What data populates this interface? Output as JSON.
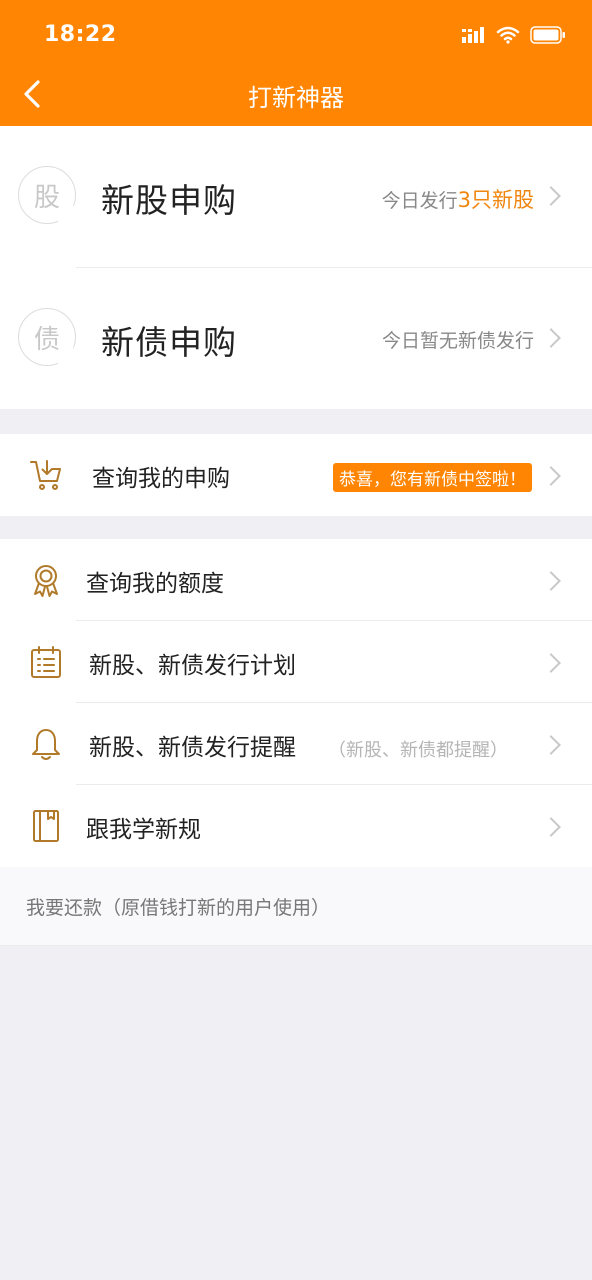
{
  "status_bar": {
    "time": "18:22"
  },
  "header": {
    "title": "打新神器"
  },
  "colors": {
    "brand": "#ff8503",
    "accent_text": "#f0860d",
    "icon": "#b07a2a",
    "background": "#f0eff4"
  },
  "subscriptions": [
    {
      "seal": "股",
      "label": "新股申购",
      "right_prefix": "今日发行",
      "right_highlight": "3只新股"
    },
    {
      "seal": "债",
      "label": "新债申购",
      "right_prefix": "今日暂无新债发行",
      "right_highlight": ""
    }
  ],
  "my_subscription": {
    "label": "查询我的申购",
    "badge": "恭喜，您有新债中签啦！",
    "icon": "cart-download-icon"
  },
  "menu": [
    {
      "label": "查询我的额度",
      "hint": "",
      "icon": "award-icon"
    },
    {
      "label": "新股、新债发行计划",
      "hint": "",
      "icon": "calendar-list-icon"
    },
    {
      "label": "新股、新债发行提醒",
      "hint": "（新股、新债都提醒）",
      "icon": "bell-icon"
    },
    {
      "label": "跟我学新规",
      "hint": "",
      "icon": "book-icon"
    }
  ],
  "footer_note": "我要还款（原借钱打新的用户使用）"
}
